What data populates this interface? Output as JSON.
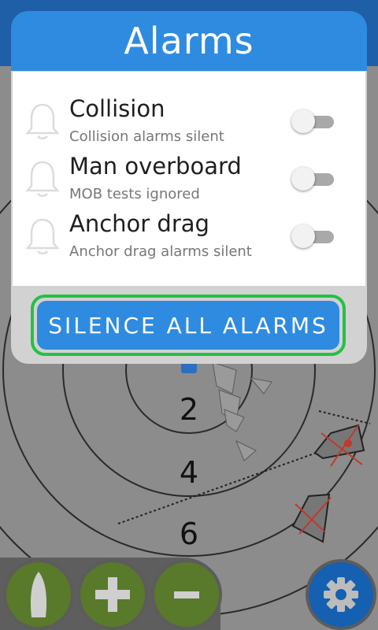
{
  "header": {
    "title": "Alarms"
  },
  "alarms": [
    {
      "title": "Collision",
      "subtitle": "Collision alarms silent",
      "enabled": false,
      "icon": "bell-icon"
    },
    {
      "title": "Man overboard",
      "subtitle": "MOB tests ignored",
      "enabled": false,
      "icon": "bell-icon"
    },
    {
      "title": "Anchor drag",
      "subtitle": "Anchor drag alarms silent",
      "enabled": false,
      "icon": "bell-icon"
    }
  ],
  "silence_button": {
    "label": "SILENCE ALL ALARMS"
  },
  "radar": {
    "range_labels": [
      "2",
      "4",
      "6"
    ]
  },
  "controls": [
    {
      "name": "boat-icon"
    },
    {
      "name": "zoom-in-icon",
      "symbol": "+"
    },
    {
      "name": "zoom-out-icon",
      "symbol": "-"
    },
    {
      "name": "settings-gear-icon"
    }
  ],
  "colors": {
    "accent_blue": "#2e8be0",
    "highlight_green": "#22c244",
    "control_green": "#587a2a",
    "alert_red": "#c0392b"
  }
}
